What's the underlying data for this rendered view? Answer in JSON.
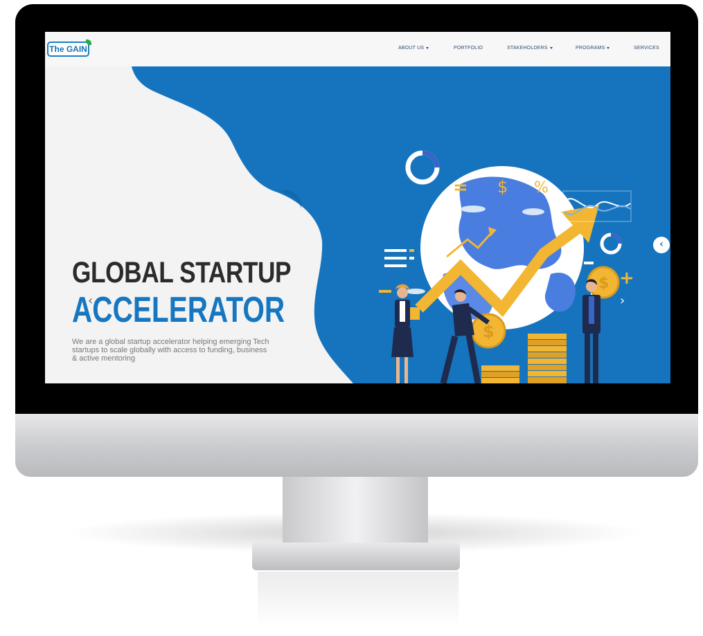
{
  "nav": {
    "logo": "The GAIN",
    "items": [
      {
        "label": "ABOUT US",
        "dropdown": true
      },
      {
        "label": "PORTFOLIO",
        "dropdown": false
      },
      {
        "label": "STAKEHOLDERS",
        "dropdown": true
      },
      {
        "label": "PROGRAMS",
        "dropdown": true
      },
      {
        "label": "SERVICES",
        "dropdown": false
      }
    ]
  },
  "hero": {
    "title_line1": "GLOBAL STARTUP",
    "title_line2": "ACCELERATOR",
    "description": "We are a global startup accelerator helping emerging Tech startups to scale globally with access to funding, business & active mentoring",
    "prev_arrow_icon": "chevron-left-icon",
    "next_arrow_icon": "chevron-right-icon",
    "symbols": {
      "equals": "=",
      "dollar": "$",
      "percent": "%",
      "plus": "+",
      "coin_dollar": "$"
    }
  },
  "colors": {
    "brand_blue": "#1677c0",
    "hero_blue": "#1574bd",
    "title_dark": "#2b2b2b",
    "gold": "#f2b632",
    "nav_text": "#2d4a78"
  }
}
